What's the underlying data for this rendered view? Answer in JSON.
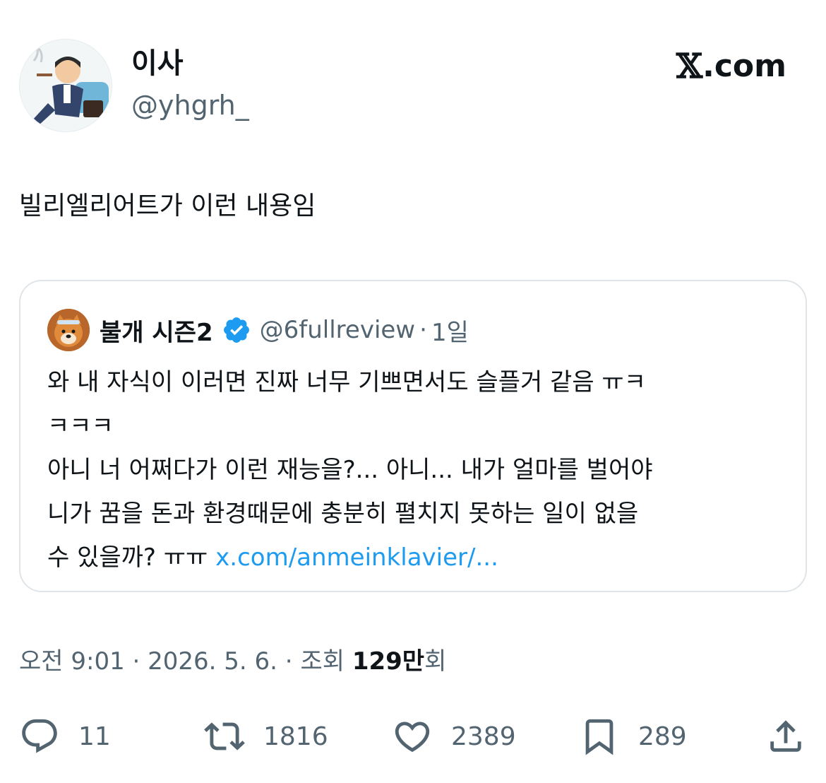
{
  "author": {
    "name": "이사",
    "handle": "@yhgrh_"
  },
  "brand": {
    "x_glyph": "𝕏",
    "suffix": ".com"
  },
  "tweet": {
    "text": "빌리엘리어트가 이런 내용임"
  },
  "quote": {
    "name": "불개 시즌2",
    "handle": "@6fullreview",
    "separator": "·",
    "time": "1일",
    "lines": [
      "와 내 자식이 이러면 진짜 너무 기쁘면서도 슬플거 같음 ㅠㅋ",
      "ㅋㅋㅋ",
      "아니 너 어쩌다가 이런 재능을?... 아니... 내가 얼마를 벌어야",
      "니가 꿈을 돈과 환경때문에 충분히 펼치지 못하는 일이 없을"
    ],
    "last_line_text": "수 있을까? ㅠㅠ ",
    "link": "x.com/anmeinklavier/...",
    "verified_icon": "verified-badge-icon"
  },
  "meta": {
    "time": "오전 9:01",
    "sep1": " · ",
    "date": "2026. 5. 6.",
    "sep2": " · ",
    "views_label": "조회 ",
    "views_value": "129만",
    "views_suffix": "회"
  },
  "actions": {
    "reply_count": "11",
    "retweet_count": "1816",
    "like_count": "2389",
    "bookmark_count": "289"
  },
  "colors": {
    "text": "#0f1419",
    "secondary": "#536471",
    "link": "#1d9bf0",
    "border": "#dfe5e8"
  }
}
